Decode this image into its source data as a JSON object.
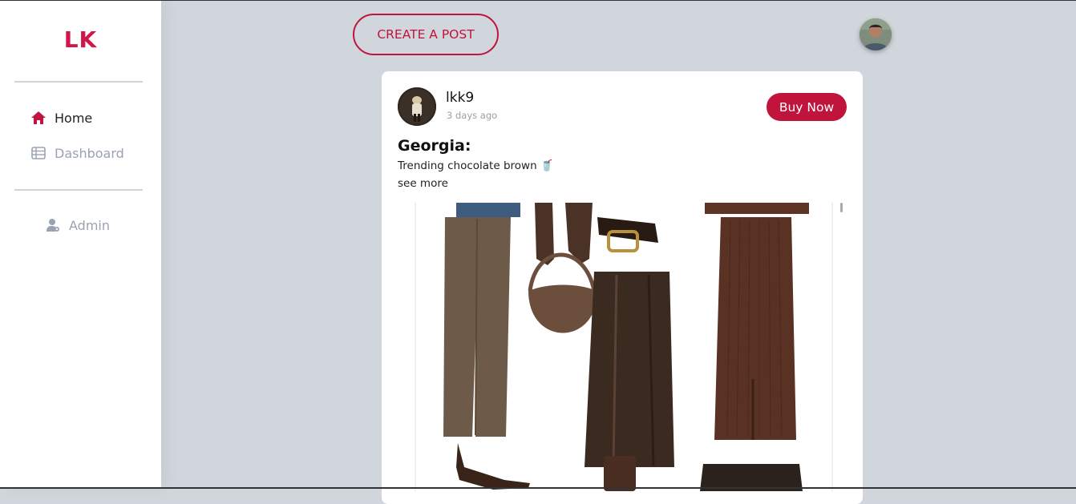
{
  "sidebar": {
    "brand": "LK",
    "items": [
      {
        "label": "Home",
        "icon": "home-icon",
        "active": true
      },
      {
        "label": "Dashboard",
        "icon": "table-icon",
        "active": false
      },
      {
        "label": "Admin",
        "icon": "admin-user-icon",
        "active": false
      }
    ]
  },
  "header": {
    "create_post_label": "CREATE A POST",
    "profile_avatar": "user-profile-avatar"
  },
  "post": {
    "username": "lkk9",
    "timestamp": "3 days ago",
    "buy_label": "Buy Now",
    "title": "Georgia:",
    "text": "Trending chocolate brown 🥤",
    "see_more": "see more",
    "image": "outfit-collage-image"
  },
  "colors": {
    "accent": "#c0143c",
    "brand": "#d0174a",
    "background": "#d1d5dc",
    "muted": "#9aa3b1"
  }
}
